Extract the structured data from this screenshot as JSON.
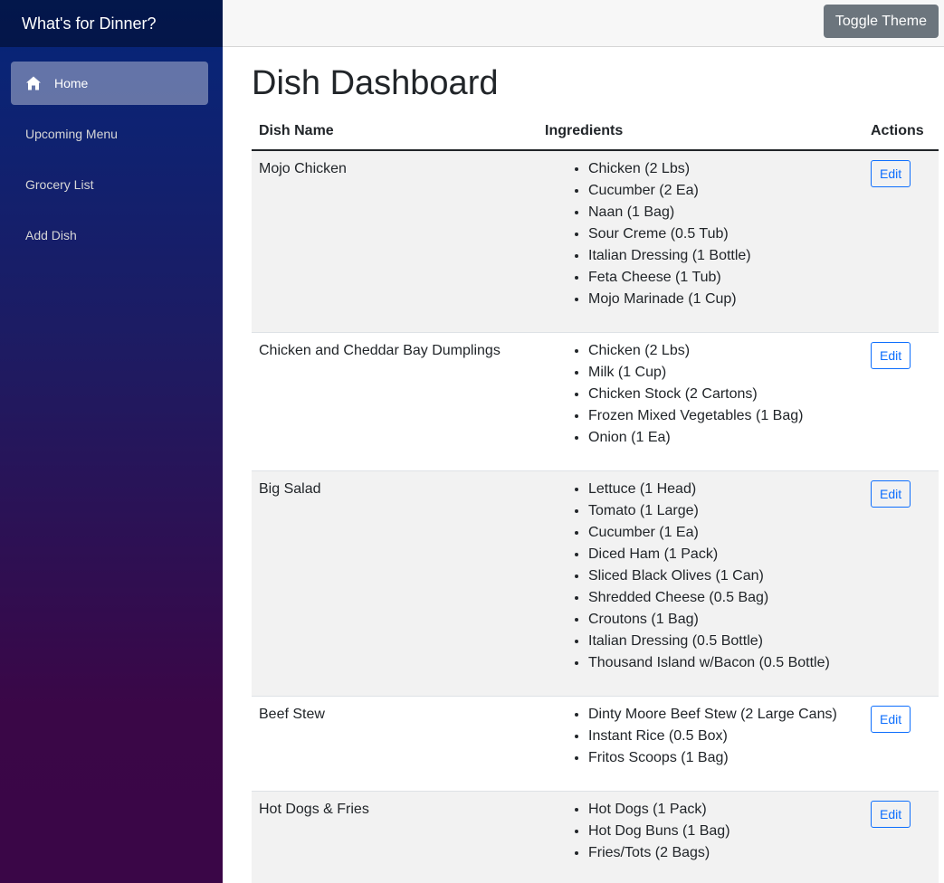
{
  "app": {
    "brand": "What's for Dinner?"
  },
  "sidebar": {
    "items": [
      {
        "label": "Home",
        "icon": "home-icon",
        "active": true
      },
      {
        "label": "Upcoming Menu",
        "active": false
      },
      {
        "label": "Grocery List",
        "active": false
      },
      {
        "label": "Add Dish",
        "active": false
      }
    ]
  },
  "topbar": {
    "toggle_theme_label": "Toggle Theme"
  },
  "main": {
    "title": "Dish Dashboard",
    "columns": [
      "Dish Name",
      "Ingredients",
      "Actions"
    ],
    "edit_label": "Edit",
    "dishes": [
      {
        "name": "Mojo Chicken",
        "ingredients": [
          "Chicken (2 Lbs)",
          "Cucumber (2 Ea)",
          "Naan (1 Bag)",
          "Sour Creme (0.5 Tub)",
          "Italian Dressing (1 Bottle)",
          "Feta Cheese (1 Tub)",
          "Mojo Marinade (1 Cup)"
        ]
      },
      {
        "name": "Chicken and Cheddar Bay Dumplings",
        "ingredients": [
          "Chicken (2 Lbs)",
          "Milk (1 Cup)",
          "Chicken Stock (2 Cartons)",
          "Frozen Mixed Vegetables (1 Bag)",
          "Onion (1 Ea)"
        ]
      },
      {
        "name": "Big Salad",
        "ingredients": [
          "Lettuce (1 Head)",
          "Tomato (1 Large)",
          "Cucumber (1 Ea)",
          "Diced Ham (1 Pack)",
          "Sliced Black Olives (1 Can)",
          "Shredded Cheese (0.5 Bag)",
          "Croutons (1 Bag)",
          "Italian Dressing (0.5 Bottle)",
          "Thousand Island w/Bacon (0.5 Bottle)"
        ]
      },
      {
        "name": "Beef Stew",
        "ingredients": [
          "Dinty Moore Beef Stew (2 Large Cans)",
          "Instant Rice (0.5 Box)",
          "Fritos Scoops (1 Bag)"
        ]
      },
      {
        "name": "Hot Dogs & Fries",
        "ingredients": [
          "Hot Dogs (1 Pack)",
          "Hot Dog Buns (1 Bag)",
          "Fries/Tots (2 Bags)"
        ]
      }
    ]
  },
  "colors": {
    "sidebar_top": "#05267a",
    "sidebar_bottom": "#3a0647",
    "primary": "#0d6efd",
    "secondary_button": "#6c757d",
    "striped_row": "#f2f2f2"
  }
}
